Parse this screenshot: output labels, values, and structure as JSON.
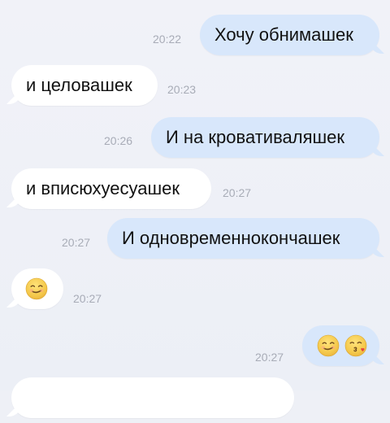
{
  "messages": [
    {
      "text": "Хочу обнимашек",
      "time": "20:22",
      "direction": "out"
    },
    {
      "text": "и целовашек",
      "time": "20:23",
      "direction": "in"
    },
    {
      "text": "И на кровативаляшек",
      "time": "20:26",
      "direction": "out"
    },
    {
      "text": "и вписюхуесуашек",
      "time": "20:27",
      "direction": "in"
    },
    {
      "text": "И одновременнокончашек",
      "time": "20:27",
      "direction": "out"
    },
    {
      "emoji": [
        "smirk-face-icon"
      ],
      "time": "20:27",
      "direction": "in"
    },
    {
      "emoji": [
        "smirk-face-icon",
        "kiss-face-icon"
      ],
      "time": "20:27",
      "direction": "out"
    }
  ],
  "colors": {
    "outgoing_bubble": "#d8e7fb",
    "incoming_bubble": "#ffffff",
    "timestamp": "#a8acb7",
    "background": "#eef0f6"
  }
}
